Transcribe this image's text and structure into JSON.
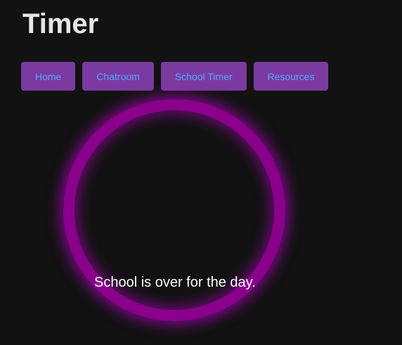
{
  "page": {
    "title": "Timer"
  },
  "nav": {
    "items": [
      {
        "label": "Home"
      },
      {
        "label": "Chatroom"
      },
      {
        "label": "School Timer"
      },
      {
        "label": "Resources"
      }
    ]
  },
  "timer": {
    "status": "School is over for the day.",
    "ring_color": "#8a008a"
  },
  "colors": {
    "background": "#121212",
    "button_bg": "#7b3aa0",
    "button_text": "#58a6ff",
    "title_text": "#e6e6e6"
  }
}
